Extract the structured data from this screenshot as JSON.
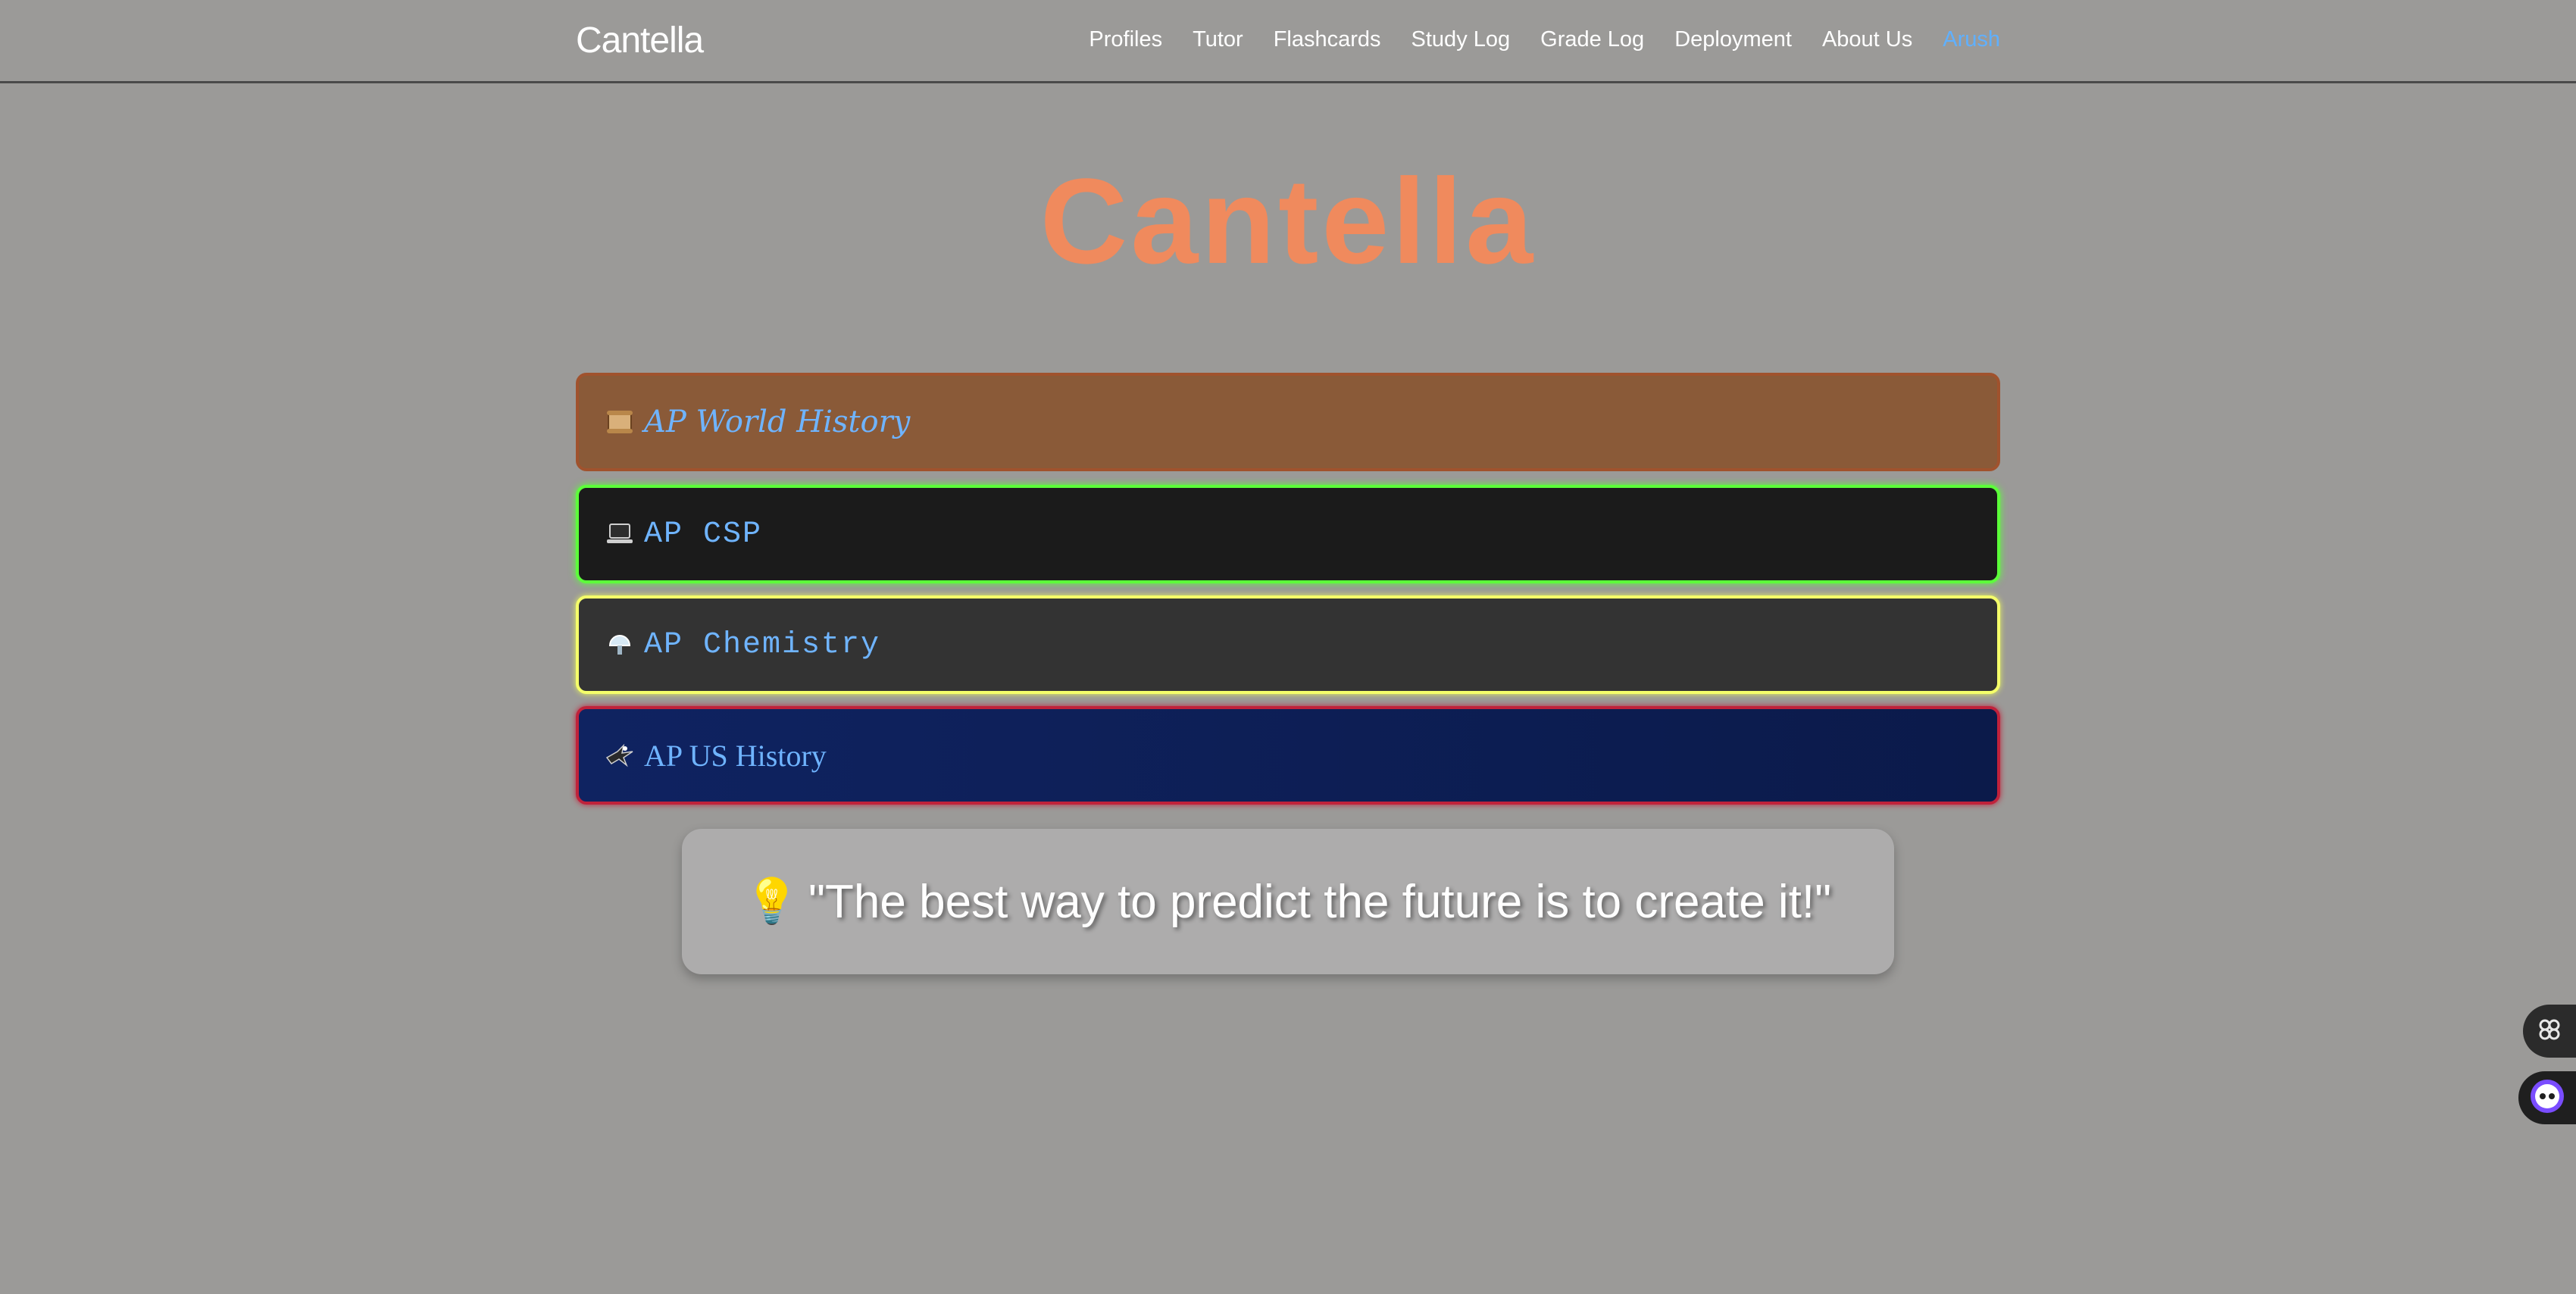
{
  "header": {
    "brand": "Cantella",
    "nav": [
      {
        "label": "Profiles"
      },
      {
        "label": "Tutor"
      },
      {
        "label": "Flashcards"
      },
      {
        "label": "Study Log"
      },
      {
        "label": "Grade Log"
      },
      {
        "label": "Deployment"
      },
      {
        "label": "About Us"
      },
      {
        "label": "Arush"
      }
    ]
  },
  "hero": {
    "title": "Cantella"
  },
  "courses": [
    {
      "label": "AP World History",
      "icon": "scroll-icon"
    },
    {
      "label": "AP CSP",
      "icon": "laptop-icon"
    },
    {
      "label": "AP Chemistry",
      "icon": "flask-icon"
    },
    {
      "label": "AP US History",
      "icon": "eagle-icon"
    }
  ],
  "quote": {
    "icon": "lightbulb-icon",
    "text": "\"The best way to predict the future is to create it!\""
  },
  "colors": {
    "background": "#9b9a98",
    "title": "#f08a5d",
    "course_label": "#6fb4ff",
    "active_user": "#5fb0ff"
  },
  "floating": [
    {
      "icon": "grid-icon"
    },
    {
      "icon": "assistant-icon"
    }
  ]
}
